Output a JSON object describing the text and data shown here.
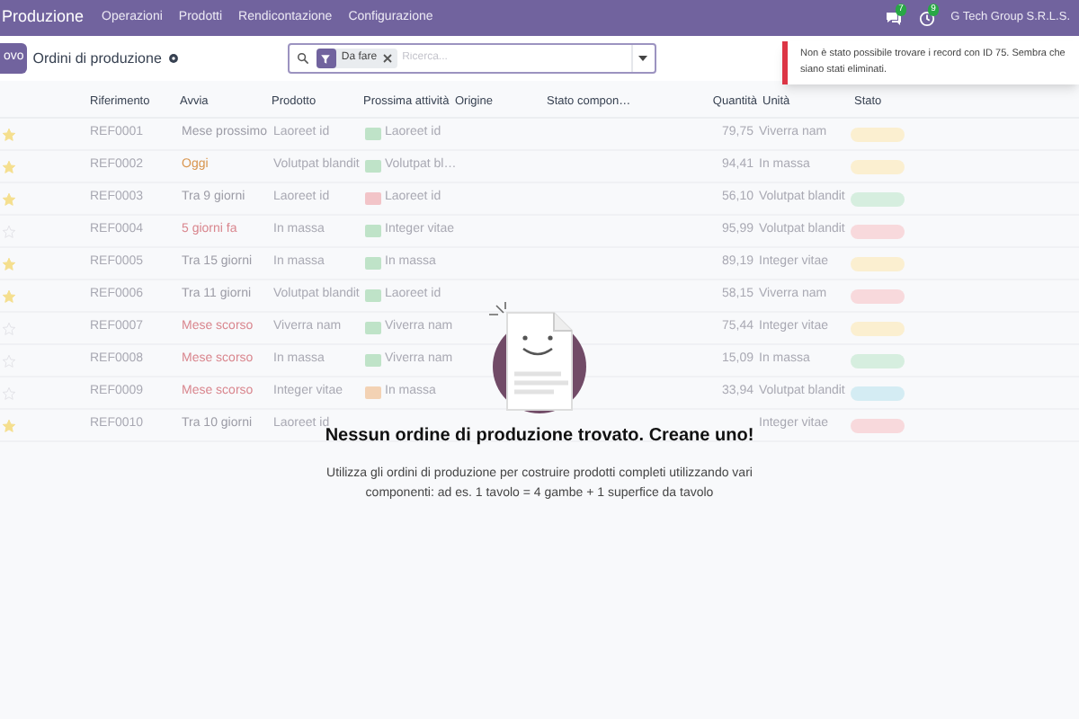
{
  "navbar": {
    "app": "Produzione",
    "menu": [
      "Operazioni",
      "Prodotti",
      "Rendicontazione",
      "Configurazione"
    ],
    "chat_badge": "7",
    "activity_badge": "9",
    "company": "G Tech Group S.R.L.S."
  },
  "control_panel": {
    "new_button": "ovo",
    "title": "Ordini di produzione",
    "search": {
      "facet": "Da fare",
      "placeholder": "Ricerca..."
    }
  },
  "notification": {
    "text": "Non è stato possibile trovare i record con ID 75. Sembra che siano stati eliminati."
  },
  "table": {
    "columns": [
      "Riferimento",
      "Avvia",
      "Prodotto",
      "Prossima attività",
      "Origine",
      "Stato compon…",
      "Quantità",
      "Unità",
      "Stato"
    ],
    "rows": [
      {
        "starred": true,
        "reference": "REF0001",
        "start": {
          "text": "Mese prossimo",
          "color": "#9c9ca6"
        },
        "product": "Laoreet id",
        "activity": {
          "text": "Laoreet id",
          "color": "#bfe3c8"
        },
        "quantity": "79,75",
        "unit": "Viverra nam",
        "status": {
          "color": "#fbefd0"
        }
      },
      {
        "starred": true,
        "reference": "REF0002",
        "start": {
          "text": "Oggi",
          "color": "#d9964f"
        },
        "product": "Volutpat blandit",
        "activity": {
          "text": "Volutpat bl…",
          "color": "#bfe3c8"
        },
        "quantity": "94,41",
        "unit": "In massa",
        "status": {
          "color": "#fbefd0"
        }
      },
      {
        "starred": true,
        "reference": "REF0003",
        "start": {
          "text": "Tra 9 giorni",
          "color": "#9c9ca6"
        },
        "product": "Laoreet id",
        "activity": {
          "text": "Laoreet id",
          "color": "#f2c4c8"
        },
        "quantity": "56,10",
        "unit": "Volutpat blandit",
        "status": {
          "color": "#d6eedf"
        }
      },
      {
        "starred": false,
        "reference": "REF0004",
        "start": {
          "text": "5 giorni fa",
          "color": "#d9868e"
        },
        "product": "In massa",
        "activity": {
          "text": "Integer vitae",
          "color": "#bfe3c8"
        },
        "quantity": "95,99",
        "unit": "Volutpat blandit",
        "status": {
          "color": "#f8d9dc"
        }
      },
      {
        "starred": true,
        "reference": "REF0005",
        "start": {
          "text": "Tra 15 giorni",
          "color": "#9c9ca6"
        },
        "product": "In massa",
        "activity": {
          "text": "In massa",
          "color": "#bfe3c8"
        },
        "quantity": "89,19",
        "unit": "Integer vitae",
        "status": {
          "color": "#fbefd0"
        }
      },
      {
        "starred": true,
        "reference": "REF0006",
        "start": {
          "text": "Tra 11 giorni",
          "color": "#9c9ca6"
        },
        "product": "Volutpat blandit",
        "activity": {
          "text": "Laoreet id",
          "color": "#bfe3c8"
        },
        "quantity": "58,15",
        "unit": "Viverra nam",
        "status": {
          "color": "#f8d9dc"
        }
      },
      {
        "starred": false,
        "reference": "REF0007",
        "start": {
          "text": "Mese scorso",
          "color": "#d9868e"
        },
        "product": "Viverra nam",
        "activity": {
          "text": "Viverra nam",
          "color": "#bfe3c8"
        },
        "quantity": "75,44",
        "unit": "Integer vitae",
        "status": {
          "color": "#fbefd0"
        }
      },
      {
        "starred": false,
        "reference": "REF0008",
        "start": {
          "text": "Mese scorso",
          "color": "#d9868e"
        },
        "product": "In massa",
        "activity": {
          "text": "Viverra nam",
          "color": "#bfe3c8"
        },
        "quantity": "15,09",
        "unit": "In massa",
        "status": {
          "color": "#d6eedf"
        }
      },
      {
        "starred": false,
        "reference": "REF0009",
        "start": {
          "text": "Mese scorso",
          "color": "#d9868e"
        },
        "product": "Integer vitae",
        "activity": {
          "text": "In massa",
          "color": "#f3d2b4"
        },
        "quantity": "33,94",
        "unit": "Volutpat blandit",
        "status": {
          "color": "#d4ecf3"
        }
      },
      {
        "starred": true,
        "reference": "REF0010",
        "start": {
          "text": "Tra 10 giorni",
          "color": "#9c9ca6"
        },
        "product": "Laoreet id",
        "unit": "Integer vitae",
        "status": {
          "color": "#f8d9dc"
        }
      }
    ]
  },
  "empty_state": {
    "title": "Nessun ordine di produzione trovato. Creane uno!",
    "text": "Utilizza gli ordini di produzione per costruire prodotti completi utilizzando vari componenti: ad es. 1 tavolo = 4 gambe + 1 superfice da tavolo"
  }
}
